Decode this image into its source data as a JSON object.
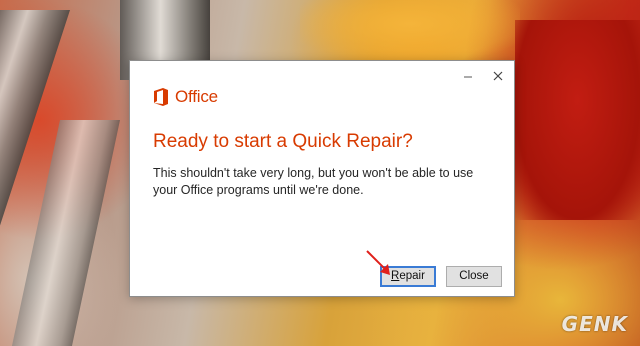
{
  "dialog": {
    "brand": "Office",
    "brand_icon": "office-logo-icon",
    "heading": "Ready to start a Quick Repair?",
    "body": "This shouldn't take very long, but you won't be able to use your Office programs until we're done.",
    "minimize_icon": "minimize-icon",
    "close_icon": "close-icon",
    "repair_button_label_mnemonic": "R",
    "repair_button_label_rest": "epair",
    "close_button_label": "Close"
  },
  "annotation": {
    "arrow_icon": "red-arrow-icon",
    "arrow_color": "#e0201b"
  },
  "watermark": {
    "text": "GENK"
  },
  "colors": {
    "accent": "#d83b01",
    "button_focus": "#3a7bd5"
  }
}
